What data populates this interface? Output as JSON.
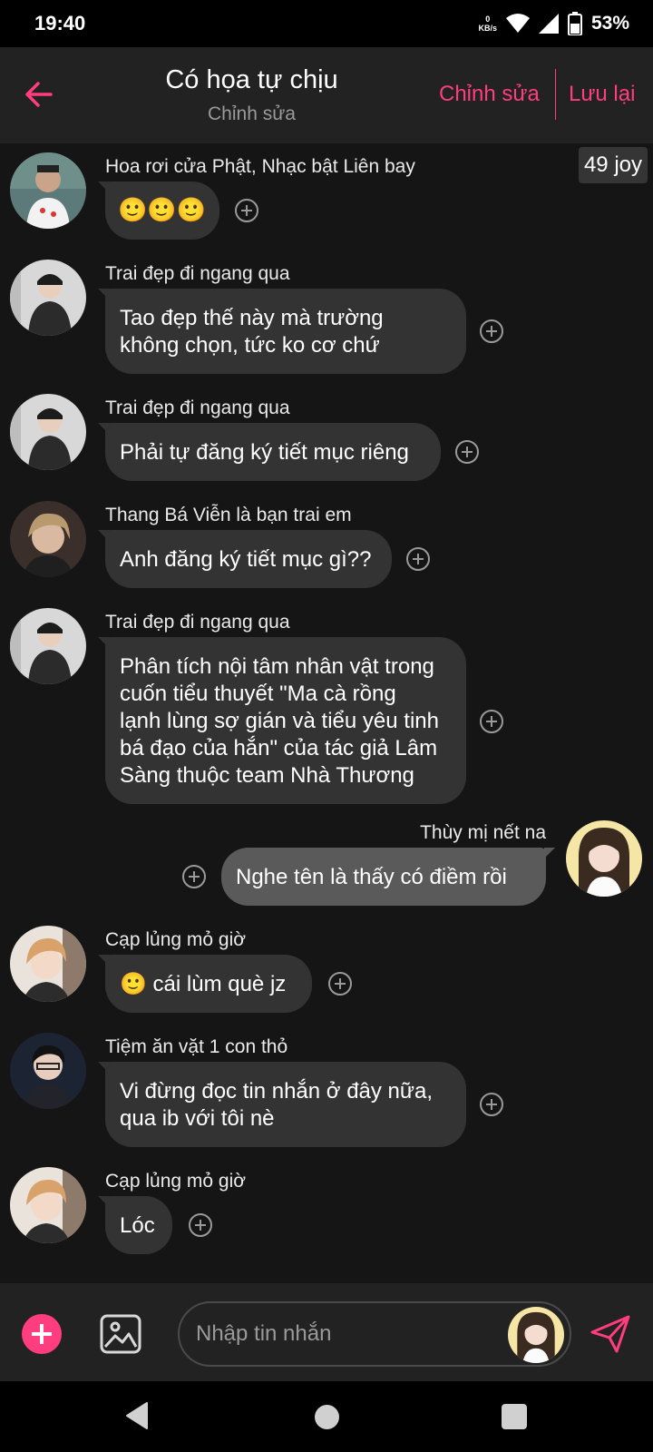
{
  "status_bar": {
    "time": "19:40",
    "net_speed_value": "0",
    "net_speed_unit": "KB/s",
    "battery_percent": "53%"
  },
  "header": {
    "title": "Có họa tự chịu",
    "subtitle": "Chỉnh sửa",
    "edit_label": "Chỉnh sửa",
    "save_label": "Lưu lại"
  },
  "joy_badge": "49 joy",
  "messages": [
    {
      "sender": "Hoa rơi cửa Phật, Nhạc bật Liên bay",
      "text_lines": [
        "🙂🙂🙂"
      ],
      "direction": "incoming"
    },
    {
      "sender": "Trai đẹp đi ngang qua",
      "text_lines": [
        "Tao đẹp thế này mà trường",
        "không chọn, tức ko cơ chứ"
      ],
      "direction": "incoming"
    },
    {
      "sender": "Trai đẹp đi ngang qua",
      "text_lines": [
        "Phải tự đăng ký tiết mục riêng"
      ],
      "direction": "incoming"
    },
    {
      "sender": "Thang Bá Viễn là bạn trai em",
      "text_lines": [
        "Anh đăng ký tiết mục gì??"
      ],
      "direction": "incoming"
    },
    {
      "sender": "Trai đẹp đi ngang qua",
      "text_lines": [
        "Phân tích nội tâm nhân vật trong",
        "cuốn tiểu thuyết \"Ma cà rồng",
        "lạnh lùng sợ gián và tiểu yêu tinh",
        "bá đạo của hắn\" của tác giả Lâm",
        "Sàng thuộc team Nhà Thương"
      ],
      "direction": "incoming"
    },
    {
      "sender": "Thùy mị nết na",
      "text_lines": [
        "Nghe tên là thấy có điềm rồi"
      ],
      "direction": "outgoing"
    },
    {
      "sender": "Cạp lủng mỏ giờ",
      "text_lines": [
        "🙂 cái lùm què jz"
      ],
      "direction": "incoming"
    },
    {
      "sender": "Tiệm ăn vặt 1 con thỏ",
      "text_lines": [
        "Vi đừng đọc tin nhắn ở đây nữa,",
        "qua ib với tôi nè"
      ],
      "direction": "incoming"
    },
    {
      "sender": "Cạp lủng mỏ giờ",
      "text_lines": [
        "Lóc"
      ],
      "direction": "incoming"
    }
  ],
  "composer": {
    "placeholder": "Nhập tin nhắn"
  },
  "colors": {
    "accent": "#ff3d7f",
    "background": "#151515",
    "header_bg": "#222222",
    "bubble_incoming": "#333333",
    "bubble_outgoing": "#5a5a5a"
  },
  "icons": {
    "back": "arrow-left-icon",
    "add_reaction": "plus-circle-icon",
    "attach": "plus-icon",
    "image": "image-icon",
    "send": "send-icon"
  }
}
